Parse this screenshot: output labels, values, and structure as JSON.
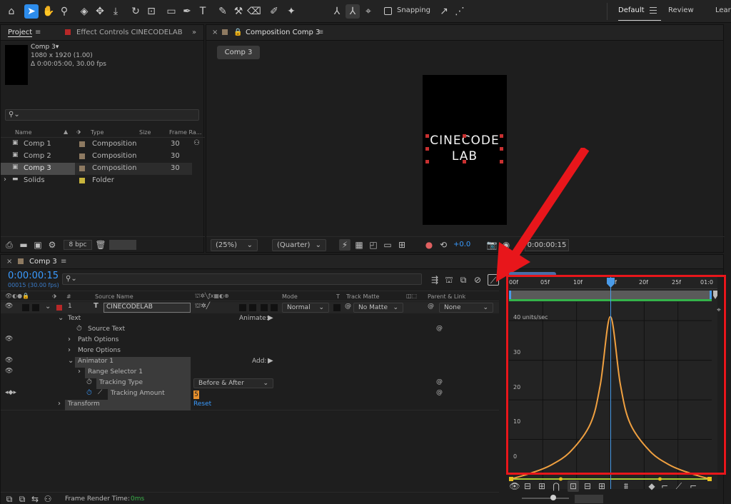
{
  "toolbar": {
    "snapping_label": "Snapping",
    "workspaces": [
      "Default",
      "Review",
      "Lear"
    ]
  },
  "project_panel": {
    "tab_project": "Project",
    "tab_effect_controls": "Effect Controls CINECODELAB",
    "comp_name": "Comp 3▾",
    "comp_size": "1080 x 1920 (1.00)",
    "comp_duration": "∆ 0:00:05:00, 30.00 fps",
    "search_placeholder": "",
    "columns": {
      "name": "Name",
      "type": "Type",
      "size": "Size",
      "frame_rate": "Frame Ra..."
    },
    "items": [
      {
        "name": "Comp 1",
        "type": "Composition",
        "frame_rate": "30",
        "color": "#8e7a61"
      },
      {
        "name": "Comp 2",
        "type": "Composition",
        "frame_rate": "30",
        "color": "#8e7a61"
      },
      {
        "name": "Comp 3",
        "type": "Composition",
        "frame_rate": "30",
        "color": "#8e7a61"
      },
      {
        "name": "Solids",
        "type": "Folder",
        "frame_rate": "",
        "color": "#c8b43c"
      }
    ],
    "bit_depth": "8 bpc"
  },
  "composition_panel": {
    "tab_label": "Composition Comp 3",
    "breadcrumb": "Comp 3",
    "text_line1": "CINECODE",
    "text_line2": "LAB",
    "zoom": "(25%)",
    "resolution": "(Quarter)",
    "exposure": "+0.0",
    "timecode": "0:00:00:15"
  },
  "timeline_panel": {
    "tab_label": "Comp 3",
    "current_time": "0:00:00:15",
    "frame_info": "00015 (30.00 fps)",
    "columns": {
      "num": "#",
      "source_name": "Source Name",
      "mode": "Mode",
      "t": "T",
      "track_matte": "Track Matte",
      "parent": "Parent & Link"
    },
    "layer": {
      "index": "1",
      "name": "CINECODELAB",
      "mode": "Normal",
      "track_matte": "No Matte",
      "parent": "None"
    },
    "props": {
      "text": "Text",
      "animate": "Animate:",
      "source_text": "Source Text",
      "path_options": "Path Options",
      "more_options": "More Options",
      "animator": "Animator 1",
      "add": "Add:",
      "range_selector": "Range Selector 1",
      "tracking_type": "Tracking Type",
      "tracking_type_value": "Before & After",
      "tracking_amount": "Tracking Amount",
      "tracking_amount_value": "5",
      "transform": "Transform",
      "reset": "Reset"
    },
    "ruler": [
      "00f",
      "05f",
      "10f",
      "15f",
      "20f",
      "25f",
      "01:0"
    ],
    "graph": {
      "unit_label": "40 units/sec",
      "y_labels": [
        "30",
        "20",
        "10",
        "0"
      ]
    },
    "footer": {
      "render_label": "Frame Render Time:",
      "render_value": "0ms"
    }
  },
  "colors": {
    "accent_blue": "#2d8ceb",
    "curve_orange": "#f0a040",
    "annotation_red": "#e8161b",
    "playhead_blue": "#4a9be8",
    "time_blue": "#3a9bff",
    "work_area_green": "#34b34a"
  },
  "chart_data": {
    "type": "line",
    "title": "",
    "x": [
      0,
      3,
      6,
      9,
      12,
      13.5,
      15,
      16.5,
      18,
      21,
      24,
      27,
      30
    ],
    "series": [
      {
        "values": [
          0,
          1.5,
          3.5,
          7,
          14,
          24,
          41,
          24,
          14,
          7,
          3.5,
          1.5,
          0
        ]
      }
    ],
    "xlabel": "",
    "ylabel": "40 units/sec",
    "ylim": [
      0,
      44
    ],
    "xlim": [
      0,
      30
    ],
    "grid": true,
    "legend": "none"
  }
}
